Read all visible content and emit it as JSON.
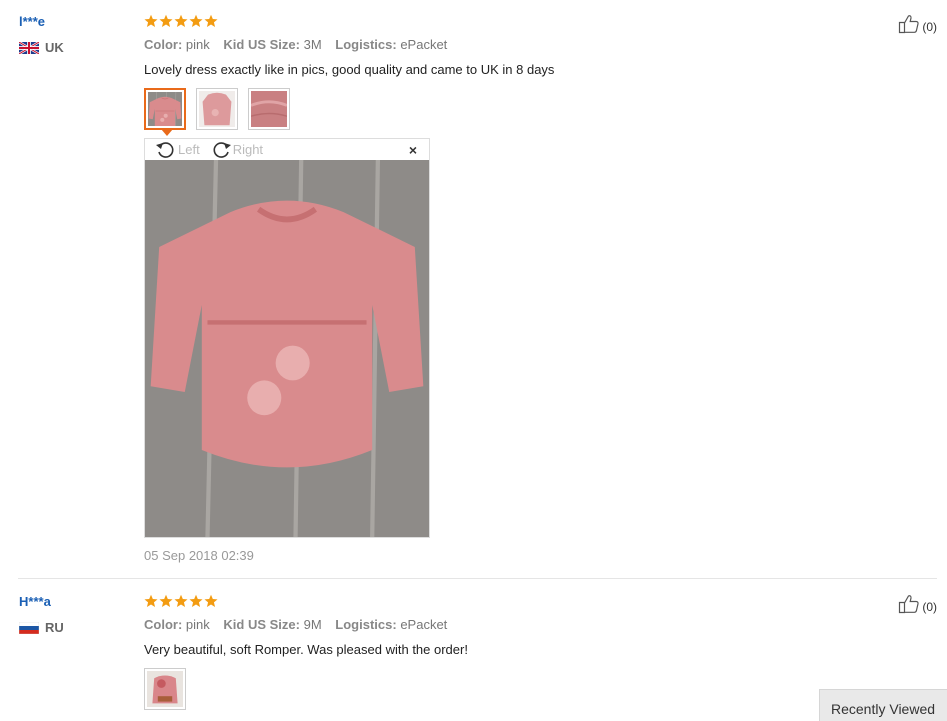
{
  "colors": {
    "star": "#f39c12",
    "name": "#1a5fb4",
    "active_border": "#e96a1a"
  },
  "reviews": [
    {
      "name": "l***e",
      "country": "UK",
      "flag_icon": "uk-flag-icon",
      "rating": 5,
      "color_label": "Color:",
      "color_value": "pink",
      "size_label": "Kid US Size:",
      "size_value": "3M",
      "logistics_label": "Logistics:",
      "logistics_value": "ePacket",
      "text": "Lovely dress exactly like in pics, good quality and came to UK in 8 days",
      "helpful_count": "(0)",
      "date": "05 Sep 2018 02:39",
      "viewer": {
        "left_label": "Left",
        "right_label": "Right",
        "close": "×"
      }
    },
    {
      "name": "H***a",
      "country": "RU",
      "flag_icon": "ru-flag-icon",
      "rating": 5,
      "color_label": "Color:",
      "color_value": "pink",
      "size_label": "Kid US Size:",
      "size_value": "9M",
      "logistics_label": "Logistics:",
      "logistics_value": "ePacket",
      "text": "Very beautiful, soft Romper. Was pleased with the order!",
      "helpful_count": "(0)"
    }
  ],
  "recently_viewed": "Recently Viewed"
}
